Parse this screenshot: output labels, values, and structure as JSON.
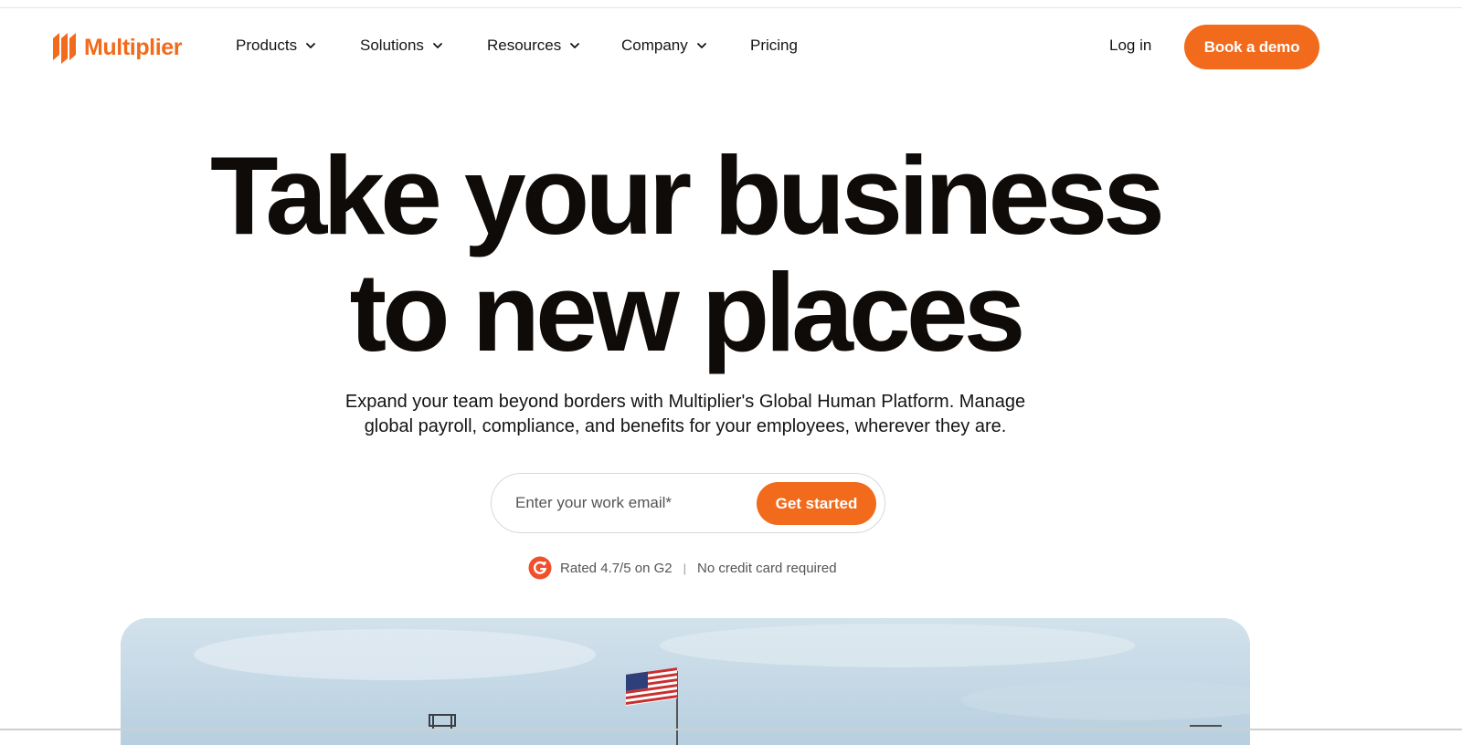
{
  "brand": {
    "name": "Multiplier",
    "color": "#f26a1b"
  },
  "nav": {
    "menu": [
      {
        "label": "Products"
      },
      {
        "label": "Solutions"
      },
      {
        "label": "Resources"
      },
      {
        "label": "Company"
      },
      {
        "label": "Pricing"
      }
    ],
    "login_label": "Log in",
    "demo_label": "Book a demo"
  },
  "hero": {
    "headline_line1": "Take your business",
    "headline_line2": "to new places",
    "subtext_line1": "Expand your team beyond borders with Multiplier's Global Human Platform. Manage",
    "subtext_line2": "global payroll, compliance, and benefits for your employees, wherever they are.",
    "email_placeholder": "Enter your work email*",
    "cta_label": "Get started",
    "rating_text": "Rated 4.7/5 on G2",
    "separator": "|",
    "no_card_text": "No credit card required"
  },
  "icons": {
    "logo": "multiplier-logo-icon",
    "chevron": "chevron-down-icon",
    "g2": "g2-badge-icon",
    "flag": "american-flag-icon"
  }
}
